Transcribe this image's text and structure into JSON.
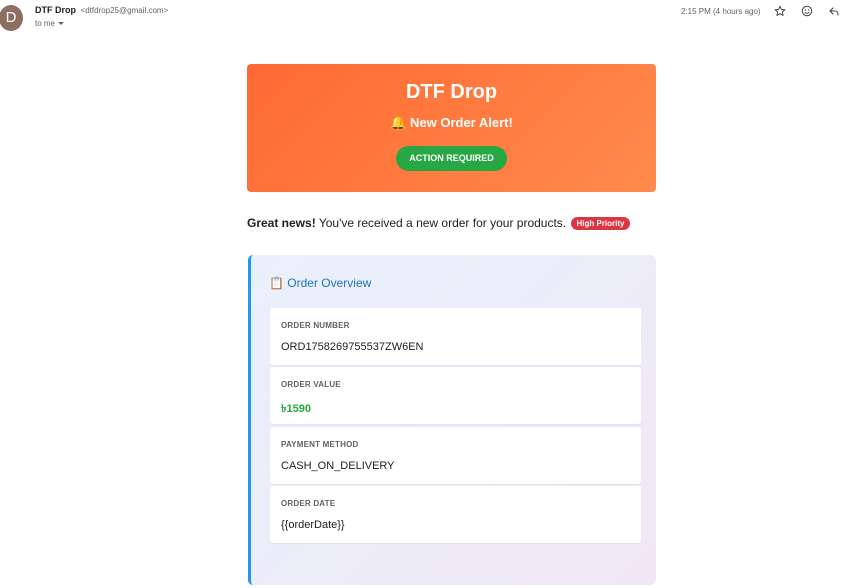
{
  "header": {
    "avatar_letter": "D",
    "sender_name": "DTF Drop",
    "sender_email": "<dtfdrop25@gmail.com>",
    "to_label": "to me",
    "timestamp": "2:15 PM (4 hours ago)",
    "icons": [
      "star-icon",
      "emoji-icon",
      "reply-icon"
    ]
  },
  "banner": {
    "brand": "DTF Drop",
    "alert": "🔔 New Order Alert!",
    "action": "ACTION REQUIRED",
    "colors": {
      "gradient_start": "#ff6a33",
      "gradient_end": "#ff8a4c",
      "button": "#28a745"
    }
  },
  "message": {
    "lead": "Great news!",
    "text": " You've received a new order for your products.",
    "badge": "High Priority"
  },
  "overview": {
    "title": "📋 Order Overview",
    "fields": [
      {
        "label": "ORDER NUMBER",
        "value": "ORD1758269755537ZW6EN"
      },
      {
        "label": "ORDER VALUE",
        "value": "৳1590"
      },
      {
        "label": "PAYMENT METHOD",
        "value": "CASH_ON_DELIVERY"
      },
      {
        "label": "ORDER DATE",
        "value": "{{orderDate}}"
      }
    ]
  }
}
